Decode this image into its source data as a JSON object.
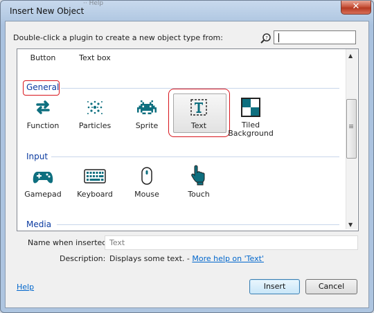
{
  "window": {
    "title": "Insert New Object",
    "close_glyph": "✕",
    "background_app_text": "·· Help"
  },
  "prompt": "Double-click a plugin to create a new object type from:",
  "search": {
    "value": ""
  },
  "partial_row": {
    "items": [
      {
        "label": "Button"
      },
      {
        "label": "Text box"
      }
    ]
  },
  "categories": [
    {
      "name": "General",
      "items": [
        {
          "label": "Function",
          "icon": "function-icon"
        },
        {
          "label": "Particles",
          "icon": "particles-icon"
        },
        {
          "label": "Sprite",
          "icon": "sprite-icon"
        },
        {
          "label": "Text",
          "icon": "text-icon",
          "selected": true
        },
        {
          "label": "Tiled\nBackground",
          "icon": "tiled-background-icon"
        }
      ]
    },
    {
      "name": "Input",
      "items": [
        {
          "label": "Gamepad",
          "icon": "gamepad-icon"
        },
        {
          "label": "Keyboard",
          "icon": "keyboard-icon"
        },
        {
          "label": "Mouse",
          "icon": "mouse-icon"
        },
        {
          "label": "Touch",
          "icon": "touch-icon"
        }
      ]
    },
    {
      "name": "Media",
      "items": []
    }
  ],
  "name_field": {
    "label": "Name when inserted:",
    "value": "Text"
  },
  "description": {
    "label": "Description:",
    "text": "Displays some text. - ",
    "link": "More help on 'Text'"
  },
  "footer": {
    "help_link": "Help",
    "insert_label": "Insert",
    "cancel_label": "Cancel"
  },
  "colors": {
    "accent": "#0a3aa0",
    "icon": "#0e6f7f",
    "highlight_red": "#d8141b"
  }
}
